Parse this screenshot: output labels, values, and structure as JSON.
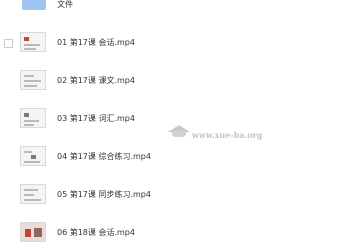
{
  "folder": {
    "label": "文件",
    "icon": "folder-icon"
  },
  "files": [
    {
      "name": "01 第17课 会话.mp4",
      "checkbox": true
    },
    {
      "name": "02 第17课 课文.mp4"
    },
    {
      "name": "03 第17课 词汇.mp4"
    },
    {
      "name": "04 第17课 综合练习.mp4"
    },
    {
      "name": "05 第17课 同步练习.mp4"
    },
    {
      "name": "06 第18课 会话.mp4"
    }
  ],
  "watermark": {
    "text": "www.xue-ba.org",
    "icon": "graduation-cap-icon"
  },
  "colors": {
    "folder": "#9ec5ee",
    "text": "#333333",
    "watermark": "#c4c4c4"
  }
}
